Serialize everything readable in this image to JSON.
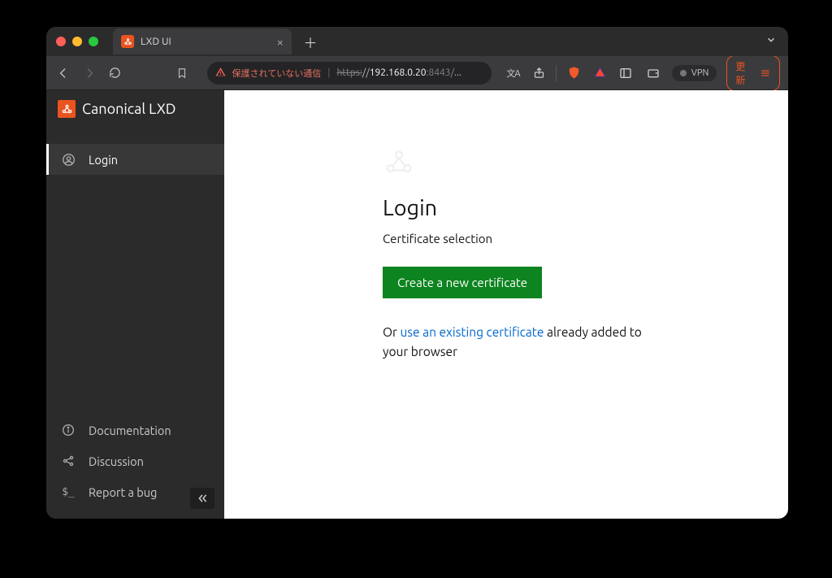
{
  "browser": {
    "tab_title": "LXD UI",
    "not_secure": "保護されていない通信",
    "url_proto": "https:",
    "url_sep": "//",
    "url_host": "192.168.0.20",
    "url_port": ":8443/",
    "url_rest": "...",
    "vpn_label": "VPN",
    "update_label": "更新"
  },
  "sidebar": {
    "brand": "Canonical LXD",
    "active": "Login",
    "bottom": {
      "docs": "Documentation",
      "discussion": "Discussion",
      "bug": "Report a bug"
    }
  },
  "main": {
    "heading": "Login",
    "subheading": "Certificate selection",
    "primary_button": "Create a new certificate",
    "note_or": "Or ",
    "note_link": "use an existing certificate",
    "note_tail": " already added to your browser"
  }
}
